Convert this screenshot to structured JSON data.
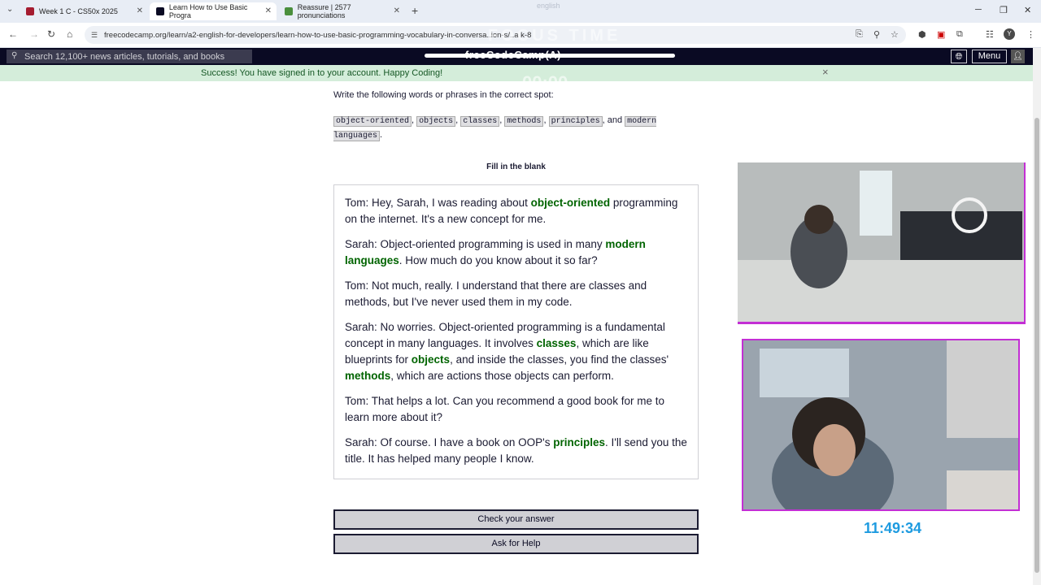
{
  "browser": {
    "tabs": [
      {
        "label": "Week 1 C - CS50x 2025",
        "color": "#a51c30"
      },
      {
        "label": "Learn How to Use Basic Progra",
        "color": "#0a0a23"
      },
      {
        "label": "Reassure | 2577 pronunciations",
        "color": "#4a8f3c"
      }
    ],
    "url": "freecodecamp.org/learn/a2-english-for-developers/learn-how-to-use-basic-programming-vocabulary-in-conversa..ion-s/..a k-8",
    "profile_initial": "Y",
    "new_tab": "+"
  },
  "overlay": {
    "focus_label": "FOCUS TIME",
    "timer": "00:00",
    "top_text": "english"
  },
  "fcc_nav": {
    "search_placeholder": "Search 12,100+ news articles, tutorials, and books",
    "logo": "freeCodeCamp(A)",
    "menu_label": "Menu"
  },
  "banner": {
    "text": "Success! You have signed in to your account. Happy Coding!",
    "close": "×"
  },
  "lesson": {
    "instruction": "Write the following words or phrases in the correct spot:",
    "words": [
      "object-oriented",
      "objects",
      "classes",
      "methods",
      "principles",
      "modern languages"
    ],
    "and": "and",
    "fill_title": "Fill in the blank",
    "paragraphs": [
      {
        "a": "Tom: Hey, Sarah, I was reading about ",
        "w1": "object-oriented",
        "b": " programming on the internet. It's a new concept for me."
      },
      {
        "a": "Sarah: Object-oriented programming is used in many ",
        "w1": "modern languages",
        "b": ". How much do you know about it so far?"
      },
      {
        "a": "Tom: Not much, really. I understand that there are classes and methods, but I've never used them in my code."
      },
      {
        "a": "Sarah: No worries. Object-oriented programming is a fundamental concept in many languages. It involves ",
        "w1": "classes",
        "b": ", which are like blueprints for ",
        "w2": "objects",
        "c": ", and inside the classes, you find the classes' ",
        "w3": "methods",
        "d": ", which are actions those objects can perform."
      },
      {
        "a": "Tom: That helps a lot. Can you recommend a good book for me to learn more about it?"
      },
      {
        "a": "Sarah: Of course. I have a book on OOP's ",
        "w1": "principles",
        "b": ". I'll send you the title. It has helped many people I know."
      }
    ],
    "check_button": "Check your answer",
    "help_button": "Ask for Help"
  },
  "stream": {
    "clock": "11:49:34",
    "frame_color": "#c32fd4"
  }
}
